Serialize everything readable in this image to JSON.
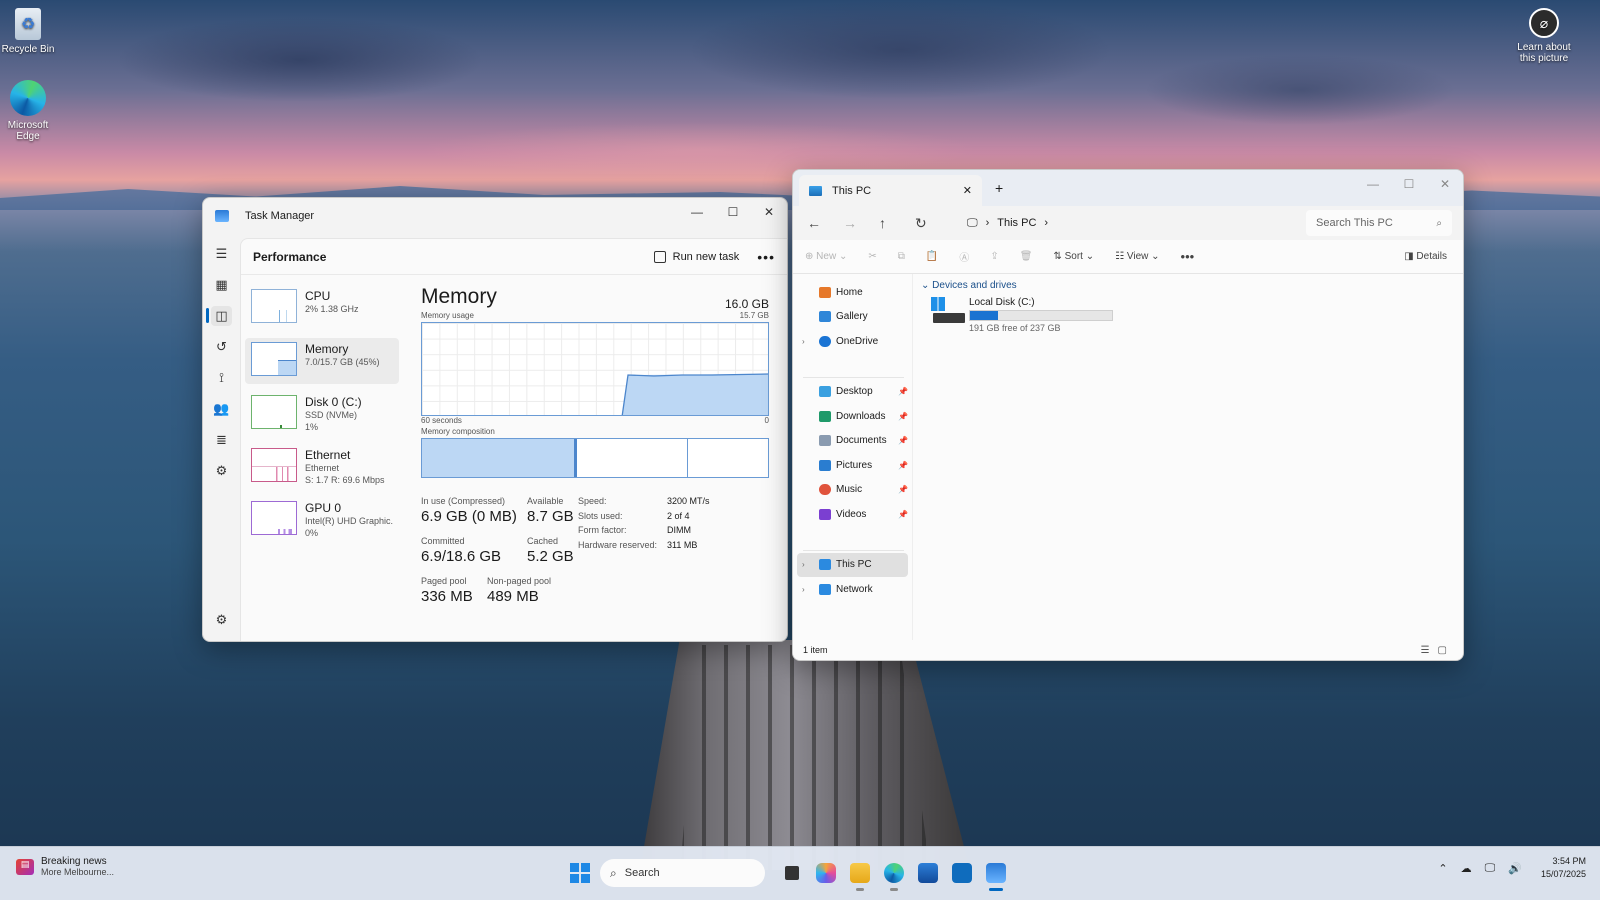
{
  "desktop": {
    "icons": [
      {
        "label": "Recycle Bin",
        "icon": "recycle-bin-icon"
      },
      {
        "label": "Microsoft Edge",
        "icon": "edge-icon"
      },
      {
        "label": "Learn about this picture",
        "icon": "camera-icon"
      }
    ]
  },
  "task_manager": {
    "title": "Task Manager",
    "section": "Performance",
    "run_new_task": "Run new task",
    "more": "•••",
    "items": [
      {
        "name": "CPU",
        "sub1": "2%  1.38 GHz",
        "sub2": "",
        "sub3": ""
      },
      {
        "name": "Memory",
        "sub1": "7.0/15.7 GB (45%)",
        "sub2": "",
        "sub3": ""
      },
      {
        "name": "Disk 0 (C:)",
        "sub1": "SSD (NVMe)",
        "sub2": "1%",
        "sub3": ""
      },
      {
        "name": "Ethernet",
        "sub1": "Ethernet",
        "sub2": "S: 1.7  R: 69.6 Mbps",
        "sub3": ""
      },
      {
        "name": "GPU 0",
        "sub1": "Intel(R) UHD Graphic...",
        "sub2": "0%",
        "sub3": ""
      }
    ],
    "memory": {
      "title": "Memory",
      "total": "16.0 GB",
      "usage_label": "Memory usage",
      "usage_max": "15.7 GB",
      "time_left": "60 seconds",
      "time_right": "0",
      "composition_label": "Memory composition",
      "stats": {
        "in_use_label": "In use (Compressed)",
        "in_use": "6.9 GB (0 MB)",
        "available_label": "Available",
        "available": "8.7 GB",
        "committed_label": "Committed",
        "committed": "6.9/18.6 GB",
        "cached_label": "Cached",
        "cached": "5.2 GB",
        "paged_label": "Paged pool",
        "paged": "336 MB",
        "nonpaged_label": "Non-paged pool",
        "nonpaged": "489 MB"
      },
      "hardware": [
        {
          "k": "Speed:",
          "v": "3200 MT/s"
        },
        {
          "k": "Slots used:",
          "v": "2 of 4"
        },
        {
          "k": "Form factor:",
          "v": "DIMM"
        },
        {
          "k": "Hardware reserved:",
          "v": "311 MB"
        }
      ]
    }
  },
  "explorer": {
    "tab_title": "This PC",
    "breadcrumb": "This PC",
    "search_placeholder": "Search This PC",
    "commands": {
      "new": "New",
      "sort": "Sort",
      "view": "View",
      "more": "•••",
      "details": "Details"
    },
    "sidebar": [
      {
        "label": "Home",
        "color": "#e6782a",
        "chev": false,
        "pin": false
      },
      {
        "label": "Gallery",
        "color": "#2f86d8",
        "chev": false,
        "pin": false
      },
      {
        "label": "OneDrive",
        "color": "#1a74d4",
        "chev": true,
        "pin": false
      },
      {
        "label": "Desktop",
        "color": "#3aa0e0",
        "chev": false,
        "pin": true
      },
      {
        "label": "Downloads",
        "color": "#1f9a6a",
        "chev": false,
        "pin": true
      },
      {
        "label": "Documents",
        "color": "#8a9bb0",
        "chev": false,
        "pin": true
      },
      {
        "label": "Pictures",
        "color": "#2a7dd0",
        "chev": false,
        "pin": true
      },
      {
        "label": "Music",
        "color": "#e0533c",
        "chev": false,
        "pin": true
      },
      {
        "label": "Videos",
        "color": "#7b3fd1",
        "chev": false,
        "pin": true
      },
      {
        "label": "This PC",
        "color": "#2b8ae0",
        "chev": true,
        "pin": false
      },
      {
        "label": "Network",
        "color": "#2b8ae0",
        "chev": true,
        "pin": false
      }
    ],
    "group": "Devices and drives",
    "drive": {
      "name": "Local Disk (C:)",
      "free": "191 GB free of 237 GB",
      "used_fraction": 0.194
    },
    "status": "1 item"
  },
  "taskbar": {
    "news_title": "Breaking news",
    "news_sub": "More Melbourne...",
    "search_label": "Search",
    "time": "3:54 PM",
    "date": "15/07/2025"
  },
  "colors": {
    "accent": "#0067c0",
    "memory_line": "#4c86cc",
    "memory_fill": "#bcd7f4"
  }
}
